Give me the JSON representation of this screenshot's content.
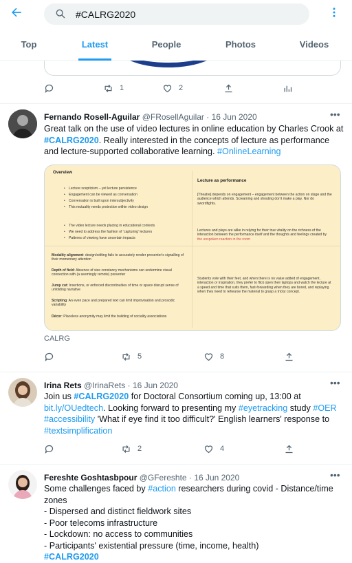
{
  "search": {
    "query": "#CALRG2020"
  },
  "tabs": [
    {
      "label": "Top",
      "active": false
    },
    {
      "label": "Latest",
      "active": true
    },
    {
      "label": "People",
      "active": false
    },
    {
      "label": "Photos",
      "active": false
    },
    {
      "label": "Videos",
      "active": false
    }
  ],
  "icons": {
    "back": "back-arrow-icon",
    "search": "search-icon",
    "more": "more-vertical-icon"
  },
  "colors": {
    "accent": "#1d9bf0",
    "text": "#0f1419",
    "muted": "#536471",
    "highlight_red": "#d04a4a",
    "slide_bg": "#fcefc8"
  },
  "prev_tweet": {
    "retweets": "1",
    "likes": "2"
  },
  "tweets": [
    {
      "name": "Fernando Rosell-Aguilar",
      "handle": "@FRosellAguilar",
      "sep": "·",
      "date": "16 Jun 2020",
      "text_1": "Great talk on the use of video lectures in online education by Charles Crook at ",
      "tag_1": "#CALRG2020",
      "text_2": ". Really interested in the concepts of lecture as performance and lecture-supported collaborative learning. ",
      "tag_2": "#OnlineLearning",
      "image_caption": "CALRG",
      "retweets": "5",
      "likes": "8"
    },
    {
      "name": "Irina Rets",
      "handle": "@IrinaRets",
      "sep": "·",
      "date": "16 Jun 2020",
      "text_1": "Join us ",
      "tag_1": "#CALRG2020",
      "text_2": " for Doctoral Consortium coming up, 13:00 at ",
      "link": "bit.ly/OUedtech",
      "text_3": ". Looking forward to presenting my ",
      "tag_2": "#eyetracking",
      "text_4": " study ",
      "tag_3": "#OER",
      "text_5": " ",
      "tag_4": "#accessibility",
      "text_6": " 'What if eye find it too difficult?' English learners' response to ",
      "tag_5": "#textsimplification",
      "retweets": "2",
      "likes": "4"
    },
    {
      "name": "Fereshte Goshtasbpour",
      "handle": "@GFereshte",
      "sep": "·",
      "date": "16 Jun 2020",
      "text_1": "Some challenges faced by ",
      "tag_1": "#action",
      "text_2": " researchers during covid - Distance/time zones",
      "line_1": "- Dispersed and distinct fieldwork sites",
      "line_2": "- Poor telecoms infrastructure",
      "line_3": "- Lockdown: no access to communities",
      "line_4": "- Participants' existential pressure (time, income, health)",
      "tag_2": "#CALRG2020"
    }
  ],
  "slide": {
    "overview_title": "Overview",
    "overview_bullets_a": [
      "Lecture scepticism – yet lecture persistence",
      "Engagement can be viewed as conversation",
      "Conversation is built upon intersubjectivity",
      "This mutuality needs protection within video design"
    ],
    "overview_bullets_b": [
      "The video lecture needs placing in educational contexts",
      "We need to address the fashion of ‘capturing’ lectures",
      "Patterns of viewing have uncertain impacts"
    ],
    "perf_title": "Lecture as performance",
    "perf_p1": "[Theatre] depends on engagement – engagement between the action on stage and the audience which attends. Screaming and shouting don't make a play.  Nor do swordfights.",
    "perf_p2": "Lectures and plays are alike in relying for their true vitality on the richness of the interaction between the performance itself and the thoughts and feelings created by ",
    "perf_p2_red": "the unspoken reaction in the room",
    "perf_p3": "Students vote with their feet, and when there is no value added of engagement, interaction or inspiration, they prefer to flick open their laptops and watch the lecture at a speed and time that suits them, fast-forwarding when they are bored, and replaying when they need to rehearse the material to grasp a tricky concept.",
    "modality": [
      {
        "label": "Modality alignment",
        "text": ": design/editing fails to accurately render presenter's signalling of their momentary attention"
      },
      {
        "label": "Depth of field",
        "text": ": Absence of size constancy mechanisms can undermine visual connection with (a seemingly remote) presenter"
      },
      {
        "label": "Jump cut",
        "text": ": Insertions, or enforced discontinuities of time or space disrupt sense of unfolding narrative"
      },
      {
        "label": "Scripting",
        "text": ": An even pace and prepared text can limit improvisation and prosodic variability"
      },
      {
        "label": "Décor",
        "text": ": Placeless anonymity may limit the building of sociality associations"
      }
    ]
  }
}
